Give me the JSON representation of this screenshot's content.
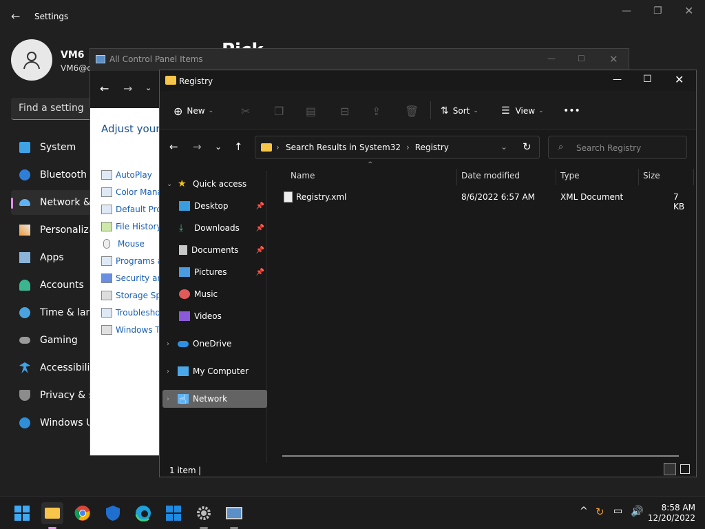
{
  "settings": {
    "title": "Settings",
    "user_name": "VM6",
    "user_email": "VM6@c",
    "big_heading": "Pick",
    "search_placeholder": "Find a setting",
    "nav": [
      "System",
      "Bluetooth &",
      "Network &",
      "Personaliza",
      "Apps",
      "Accounts",
      "Time & lang",
      "Gaming",
      "Accessibility",
      "Privacy & se",
      "Windows U"
    ]
  },
  "control_panel": {
    "title": "All Control Panel Items",
    "heading": "Adjust your",
    "items": [
      "AutoPlay",
      "Color Manag",
      "Default Prog",
      "File History",
      "Mouse",
      "Programs an",
      "Security and",
      "Storage Spac",
      "Troubleshoo",
      "Windows To"
    ]
  },
  "explorer": {
    "title": "Registry",
    "toolbar": {
      "new": "New",
      "sort": "Sort",
      "view": "View",
      "more": "•••"
    },
    "breadcrumb": [
      "Search Results in System32",
      "Registry"
    ],
    "search_placeholder": "Search Registry",
    "nav_pane": {
      "quick_access": "Quick access",
      "items": [
        "Desktop",
        "Downloads",
        "Documents",
        "Pictures",
        "Music",
        "Videos"
      ],
      "onedrive": "OneDrive",
      "my_computer": "My Computer",
      "network": "Network"
    },
    "columns": {
      "name": "Name",
      "date": "Date modified",
      "type": "Type",
      "size": "Size"
    },
    "file": {
      "name": "Registry.xml",
      "date": "8/6/2022 6:57 AM",
      "type": "XML Document",
      "size": "7 KB"
    },
    "status": "1 item"
  },
  "taskbar": {
    "time": "8:58 AM",
    "date": "12/20/2022"
  },
  "colors": {
    "accent": "#e28de6",
    "link": "#1a5fb4",
    "folder": "#f7c54a"
  }
}
